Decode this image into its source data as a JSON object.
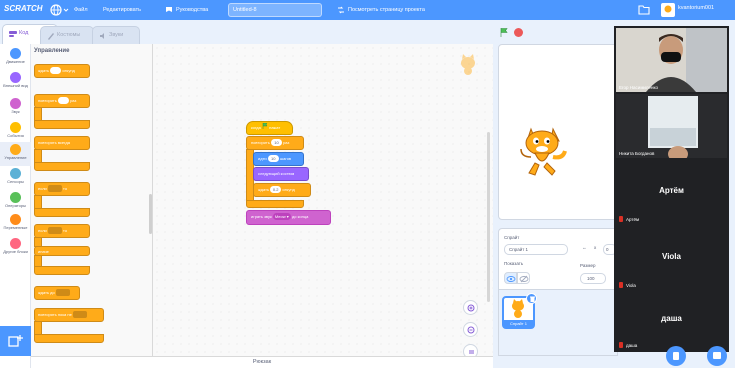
{
  "menubar": {
    "logo": "SCRATCH",
    "file": "Файл",
    "edit": "Редактировать",
    "tutorials": "Руководства",
    "project_title": "Untitled-8",
    "see_project": "Посмотреть страницу проекта",
    "username": "kvantorium001"
  },
  "tabs": {
    "code": "Код",
    "costumes": "Костюмы",
    "sounds": "Звуки"
  },
  "categories": [
    {
      "label": "Движение",
      "color": "#4c97ff"
    },
    {
      "label": "Внешний вид",
      "color": "#9966ff"
    },
    {
      "label": "Звук",
      "color": "#cf63cf"
    },
    {
      "label": "События",
      "color": "#ffbf00"
    },
    {
      "label": "Управление",
      "color": "#ffab19"
    },
    {
      "label": "Сенсоры",
      "color": "#5cb1d6"
    },
    {
      "label": "Операторы",
      "color": "#59c059"
    },
    {
      "label": "Переменные",
      "color": "#ff8c1a"
    },
    {
      "label": "Другие блоки",
      "color": "#ff6680"
    }
  ],
  "palette": {
    "title": "Управление",
    "blocks": {
      "wait": "ждать",
      "wait_num": "1",
      "wait_unit": "секунд",
      "repeat": "повторить",
      "repeat_num": "10",
      "repeat_unit": "раз",
      "forever": "повторять всегда",
      "if": "если",
      "then": "то",
      "if2": "если",
      "then2": "то",
      "else": "иначе",
      "wait_until": "ждать до",
      "repeat_until": "повторять пока не"
    }
  },
  "script": {
    "hat": "когда",
    "hat_tail": "нажат",
    "repeat": "повторить",
    "repeat_num": "10",
    "repeat_unit": "раз",
    "move": "идти",
    "move_num": "10",
    "move_unit": "шагов",
    "next_costume": "следующий костюм",
    "wait": "ждать",
    "wait_num": "0.2",
    "wait_unit": "секунд",
    "play_sound": "играть звук",
    "sound_name": "Meow",
    "sound_tail": "до конца"
  },
  "backpack": "Рюкзак",
  "sprite_info": {
    "sprite_label": "Спрайт",
    "sprite_name": "Спрайт 1",
    "show_label": "Показать",
    "size_label": "Размер",
    "size_value": "100",
    "x_label": "x",
    "x_value": "0"
  },
  "sprite_list": {
    "thumb_label": "Спрайт 1"
  },
  "call": {
    "participants": [
      {
        "name": "Егор Насимиленко",
        "type": "video"
      },
      {
        "name": "Никита Богданов",
        "type": "video"
      },
      {
        "name": "Артём",
        "type": "tile",
        "label": "Артём"
      },
      {
        "name": "Viola",
        "type": "tile",
        "label": "Viola"
      },
      {
        "name": "даша",
        "type": "tile",
        "label": "даша"
      }
    ]
  }
}
